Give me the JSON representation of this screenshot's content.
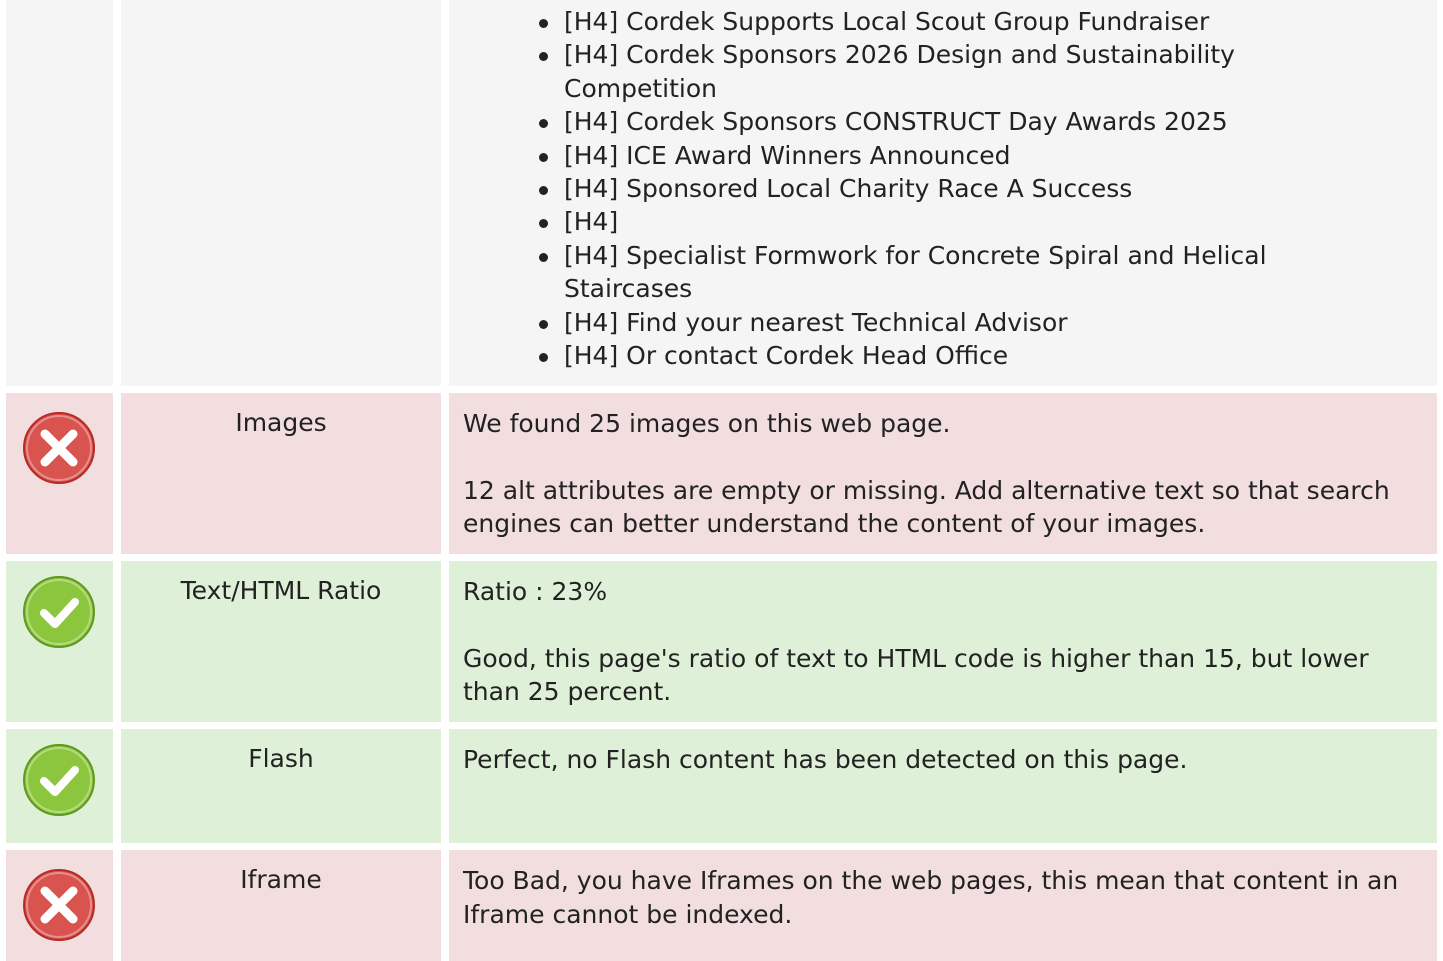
{
  "headings": {
    "items": [
      "[H4] Cordek Supports Local Scout Group Fundraiser",
      "[H4] Cordek Sponsors 2026 Design and Sustainability Competition",
      "[H4] Cordek Sponsors CONSTRUCT Day Awards 2025",
      "[H4] ICE Award Winners Announced",
      "[H4] Sponsored Local Charity Race A Success",
      "[H4]",
      "[H4] Specialist Formwork for Concrete Spiral and Helical Staircases",
      "[H4] Find your nearest Technical Advisor",
      "[H4] Or contact Cordek Head Office"
    ]
  },
  "rows": {
    "images": {
      "status": "error",
      "status_icon": "error-cross-icon",
      "label": "Images",
      "line1": "We found 25 images on this web page.",
      "line2": "12 alt attributes are empty or missing. Add alternative text so that search engines can better understand the content of your images."
    },
    "ratio": {
      "status": "ok",
      "status_icon": "success-check-icon",
      "label": "Text/HTML Ratio",
      "line1": "Ratio : 23%",
      "line2": "Good, this page's ratio of text to HTML code is higher than 15, but lower than 25 percent."
    },
    "flash": {
      "status": "ok",
      "status_icon": "success-check-icon",
      "label": "Flash",
      "line1": "Perfect, no Flash content has been detected on this page."
    },
    "iframe": {
      "status": "error",
      "status_icon": "error-cross-icon",
      "label": "Iframe",
      "line1": "Too Bad, you have Iframes on the web pages, this mean that content in an Iframe cannot be indexed."
    }
  },
  "colors": {
    "neutral_bg": "#f5f5f5",
    "error_bg": "#f2dede",
    "success_bg": "#dff0d8",
    "error_icon": "#d9534f",
    "success_icon": "#8cc63f",
    "text": "#222222"
  }
}
